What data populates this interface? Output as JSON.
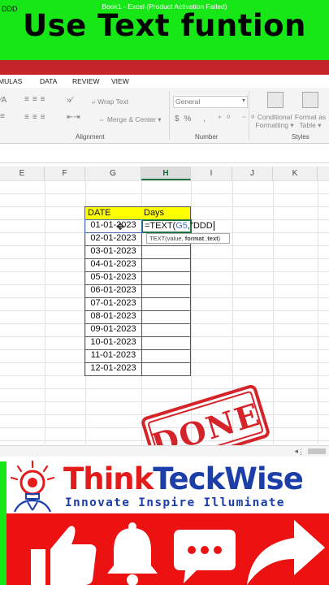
{
  "banner": {
    "title": "Use Text funtion"
  },
  "excel": {
    "window_title": "Book1 -  Excel (Product Activation Failed)",
    "tabs": [
      "MULAS",
      "DATA",
      "REVIEW",
      "VIEW"
    ],
    "ribbon": {
      "wrap_text": "Wrap Text",
      "merge_center": "Merge & Center",
      "number_format": "General",
      "conditional_formatting": [
        "Conditional",
        "Formatting"
      ],
      "format_as_table": [
        "Format as",
        "Table"
      ],
      "group_alignment": "Alignment",
      "group_number": "Number",
      "group_styles": "Styles"
    },
    "formula_bar_text": "DDD",
    "columns": [
      "E",
      "F",
      "G",
      "H",
      "I",
      "J",
      "K"
    ],
    "header_date": "DATE",
    "header_days": "Days",
    "dates": [
      "01-01-2023",
      "02-01-2023",
      "03-01-2023",
      "04-01-2023",
      "05-01-2023",
      "06-01-2023",
      "07-01-2023",
      "08-01-2023",
      "09-01-2023",
      "10-01-2023",
      "11-01-2023",
      "12-01-2023"
    ],
    "formula": {
      "prefix": "=TEXT(",
      "ref": "G5",
      "suffix": ",\"DDD"
    },
    "tooltip": {
      "fn": "TEXT(value, ",
      "arg": "format_text",
      "close": ")"
    }
  },
  "stamp": {
    "text": "DONE"
  },
  "brand": {
    "name_part1": "Think",
    "name_part2": "TeckWise",
    "tagline": "Innovate Inspire Illuminate"
  },
  "colors": {
    "green": "#17e617",
    "excel_red": "#c5242b",
    "yellow": "#ffff00",
    "brand_red": "#e31b1b",
    "brand_blue": "#1b3ea8",
    "bottom_red": "#ed1212"
  },
  "icons": [
    "like-icon",
    "bell-icon",
    "comment-icon",
    "share-icon",
    "bulb-logo-icon"
  ]
}
